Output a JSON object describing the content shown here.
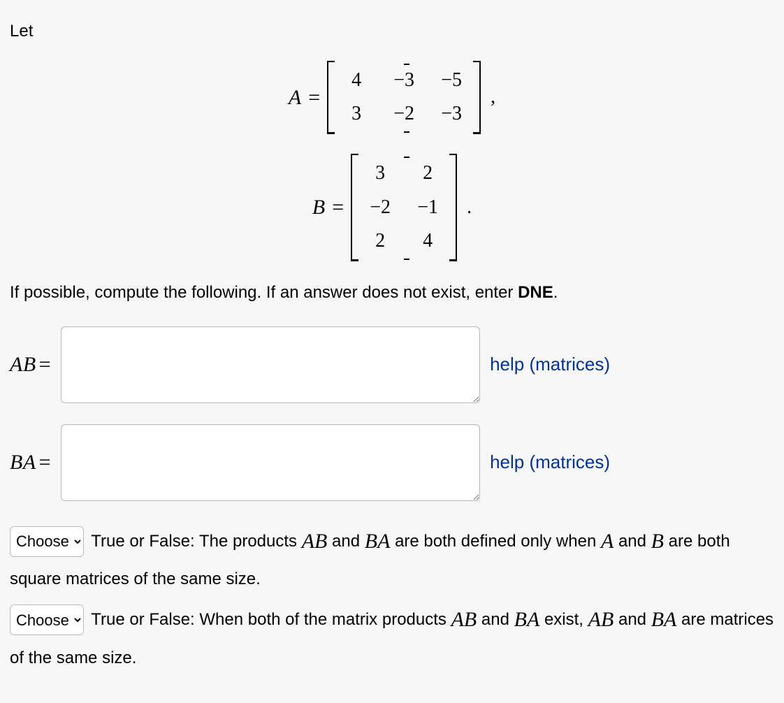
{
  "intro": "Let",
  "matrixA": {
    "name": "A",
    "rows": [
      [
        "4",
        "−3",
        "−5"
      ],
      [
        "3",
        "−2",
        "−3"
      ]
    ],
    "trail": ","
  },
  "matrixB": {
    "name": "B",
    "rows": [
      [
        "3",
        "2"
      ],
      [
        "−2",
        "−1"
      ],
      [
        "2",
        "4"
      ]
    ],
    "trail": "."
  },
  "instruct_pre": "If possible, compute the following. If an answer does not exist, enter ",
  "instruct_bold": "DNE",
  "instruct_post": ".",
  "answers": {
    "ab": {
      "label_left": "AB",
      "eq": "="
    },
    "ba": {
      "label_left": "BA",
      "eq": "="
    }
  },
  "help_text": "help (matrices)",
  "tf": {
    "placeholder": "Choose",
    "q1_pre": " True or False: The products ",
    "q1_mid1": "AB",
    "q1_mid_text": " and ",
    "q1_mid2": "BA",
    "q1_mid_text2": " are both defined only when ",
    "q1_A": "A",
    "q1_and": " and ",
    "q1_B": "B",
    "q1_post": " are both square matrices of the same size.",
    "q2_pre": " True or False: When both of the matrix products ",
    "q2_mid1": "AB",
    "q2_and": " and ",
    "q2_mid2": "BA",
    "q2_exist": " exist, ",
    "q2_mid3": "AB",
    "q2_and2": " and ",
    "q2_mid4": "BA",
    "q2_post": " are matrices of the same size."
  }
}
